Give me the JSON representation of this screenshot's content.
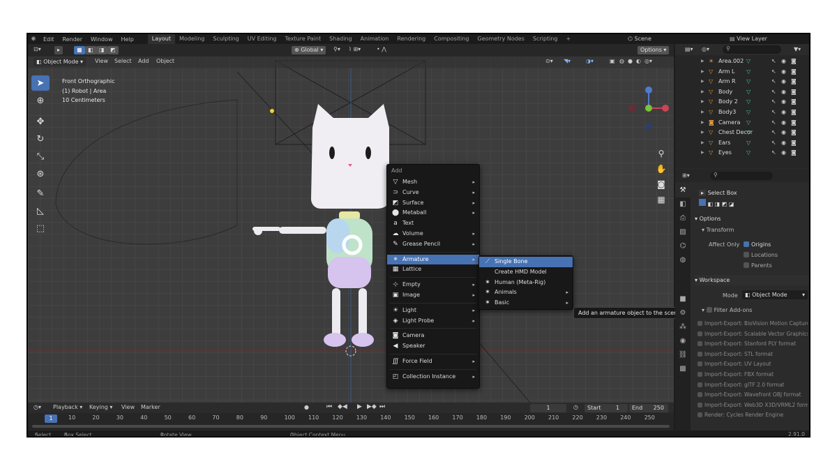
{
  "topbar": {
    "menus": [
      "Edit",
      "Render",
      "Window",
      "Help"
    ],
    "workspaces": [
      "Layout",
      "Modeling",
      "Sculpting",
      "UV Editing",
      "Texture Paint",
      "Shading",
      "Animation",
      "Rendering",
      "Compositing",
      "Geometry Nodes",
      "Scripting"
    ],
    "active_workspace": "Layout",
    "add_tab": "+",
    "scene": "Scene",
    "view_layer": "View Layer"
  },
  "viewport": {
    "mode": "Object Mode",
    "menus": [
      "View",
      "Select",
      "Add",
      "Object"
    ],
    "orientation": "Global",
    "options_label": "Options",
    "info_lines": [
      "Front Orthographic",
      "(1) Robot | Area",
      "10 Centimeters"
    ]
  },
  "add_menu": {
    "title": "Add",
    "items": [
      {
        "icon": "mesh-icon",
        "glyph": "▽",
        "label": "Mesh",
        "sub": true
      },
      {
        "icon": "curve-icon",
        "glyph": "⊃",
        "label": "Curve",
        "sub": true
      },
      {
        "icon": "surface-icon",
        "glyph": "◩",
        "label": "Surface",
        "sub": true
      },
      {
        "icon": "metaball-icon",
        "glyph": "⬤",
        "label": "Metaball",
        "sub": true
      },
      {
        "icon": "text-icon",
        "glyph": "a",
        "label": "Text",
        "sub": false
      },
      {
        "icon": "volume-icon",
        "glyph": "☁",
        "label": "Volume",
        "sub": true
      },
      {
        "icon": "grease-pencil-icon",
        "glyph": "✎",
        "label": "Grease Pencil",
        "sub": true
      },
      {
        "icon": "armature-icon",
        "glyph": "✶",
        "label": "Armature",
        "sub": true,
        "highlight": true
      },
      {
        "icon": "lattice-icon",
        "glyph": "▦",
        "label": "Lattice",
        "sub": false
      },
      {
        "icon": "empty-icon",
        "glyph": "⊹",
        "label": "Empty",
        "sub": true
      },
      {
        "icon": "image-icon",
        "glyph": "▣",
        "label": "Image",
        "sub": true
      },
      {
        "icon": "light-icon",
        "glyph": "☀",
        "label": "Light",
        "sub": true
      },
      {
        "icon": "light-probe-icon",
        "glyph": "◈",
        "label": "Light Probe",
        "sub": true
      },
      {
        "icon": "camera-icon",
        "glyph": "◙",
        "label": "Camera",
        "sub": false
      },
      {
        "icon": "speaker-icon",
        "glyph": "◀",
        "label": "Speaker",
        "sub": false
      },
      {
        "icon": "force-field-icon",
        "glyph": "∭",
        "label": "Force Field",
        "sub": true
      },
      {
        "icon": "collection-instance-icon",
        "glyph": "◰",
        "label": "Collection Instance",
        "sub": true
      }
    ]
  },
  "armature_submenu": {
    "items": [
      "Single Bone",
      "Create HMD Model",
      "Human (Meta-Rig)",
      "Animals",
      "Basic"
    ],
    "tooltip": "Add an armature object to the scene."
  },
  "outliner": {
    "rows": [
      "Area.002",
      "Arm L",
      "Arm R",
      "Body",
      "Body 2",
      "Body3",
      "Camera",
      "Chest Decor",
      "Ears",
      "Eyes"
    ]
  },
  "properties": {
    "tool_name": "Select Box",
    "options_label": "Options",
    "transform_label": "Transform",
    "affect_only_label": "Affect Only",
    "affect_only": [
      "Origins",
      "Locations",
      "Parents"
    ],
    "workspace_label": "Workspace",
    "mode_label": "Mode",
    "mode_value": "Object Mode",
    "filter_addons_label": "Filter Add-ons",
    "addons": [
      "Import-Export: BioVision Motion Capture (BVH) format",
      "Import-Export: Scalable Vector Graphics (SVG) 1.1 format",
      "Import-Export: Stanford PLY format",
      "Import-Export: STL format",
      "Import-Export: UV Layout",
      "Import-Export: FBX format",
      "Import-Export: glTF 2.0 format",
      "Import-Export: Wavefront OBJ format",
      "Import-Export: Web3D X3D/VRML2 format",
      "Render: Cycles Render Engine"
    ]
  },
  "timeline": {
    "menus": [
      "Playback",
      "Keying",
      "View",
      "Marker"
    ],
    "current_frame": "1",
    "start_label": "Start",
    "start": "1",
    "end_label": "End",
    "end": "250",
    "ruler": [
      "1",
      "10",
      "20",
      "30",
      "40",
      "50",
      "60",
      "70",
      "80",
      "90",
      "100",
      "110",
      "120",
      "130",
      "140",
      "150",
      "160",
      "170",
      "180",
      "190",
      "200",
      "210",
      "220",
      "230",
      "240",
      "250"
    ]
  },
  "statusbar": {
    "select": "Select",
    "box_select": "Box Select",
    "rotate_view": "Rotate View",
    "context_menu": "Object Context Menu",
    "version": "2.91.0"
  },
  "colors": {
    "accent": "#4772b3",
    "bg": "#1d1d1d",
    "viewport": "#3d3d3d"
  }
}
